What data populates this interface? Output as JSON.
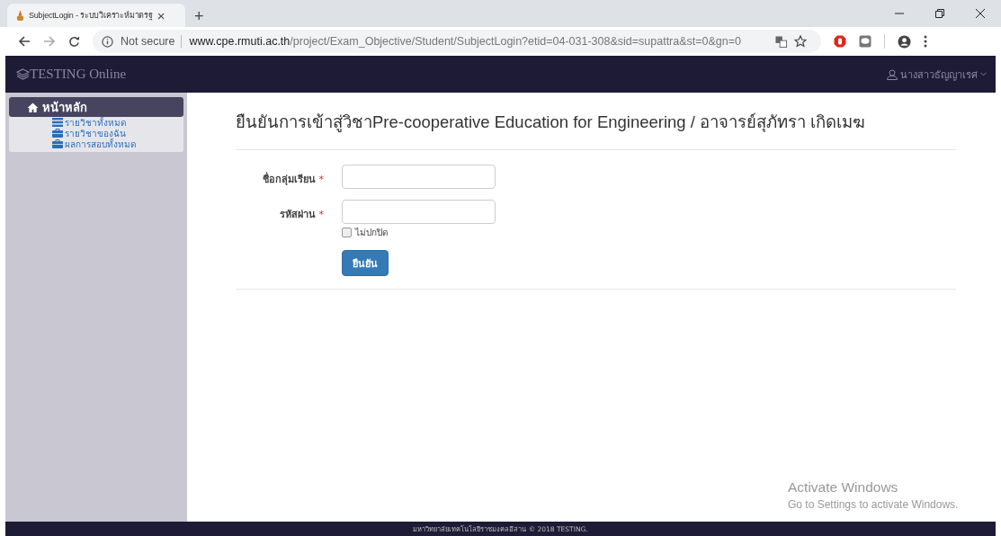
{
  "browser": {
    "tab": {
      "title": "SubjectLogin - ระบบวิเคราะห์มาตรฐ",
      "close": "×"
    },
    "new_tab": "+",
    "url": {
      "security": "Not secure",
      "domain": "www.cpe.rmuti.ac.th",
      "path": "/project/Exam_Objective/Student/SubjectLogin?etid=04-031-308&sid=supattra&st=0&gn=0"
    }
  },
  "navbar": {
    "brand": "TESTING Online",
    "user": "นางสาวธัญญาเรศ"
  },
  "sidebar": {
    "heading": "หน้าหลัก",
    "items": [
      {
        "label": "รายวิชาทั้งหมด",
        "kind": "list"
      },
      {
        "label": "รายวิชาของฉัน",
        "kind": "briefcase"
      },
      {
        "label": "ผลการสอบทั้งหมด",
        "kind": "briefcase"
      }
    ]
  },
  "page": {
    "title": "ยืนยันการเข้าสู่วิชาPre-cooperative Education for Engineering / อาจารย์สุภัทรา เกิดเมฆ",
    "fields": [
      {
        "label": "ชื่อกลุ่มเรียน",
        "mark": "*",
        "kind": "text"
      },
      {
        "label": "รหัสผ่าน",
        "mark": "*",
        "kind": "password"
      }
    ],
    "show_password": {
      "label": "ไม่ปกปิด",
      "checked": false
    },
    "submit": "ยืนยัน"
  },
  "footer": "มหาวิทยาลัยเทคโนโลยีราชมงคลอีสาน © 2018 TESTING.",
  "os_notice": {
    "title": "Activate Windows",
    "text": "Go to Settings to activate Windows."
  }
}
